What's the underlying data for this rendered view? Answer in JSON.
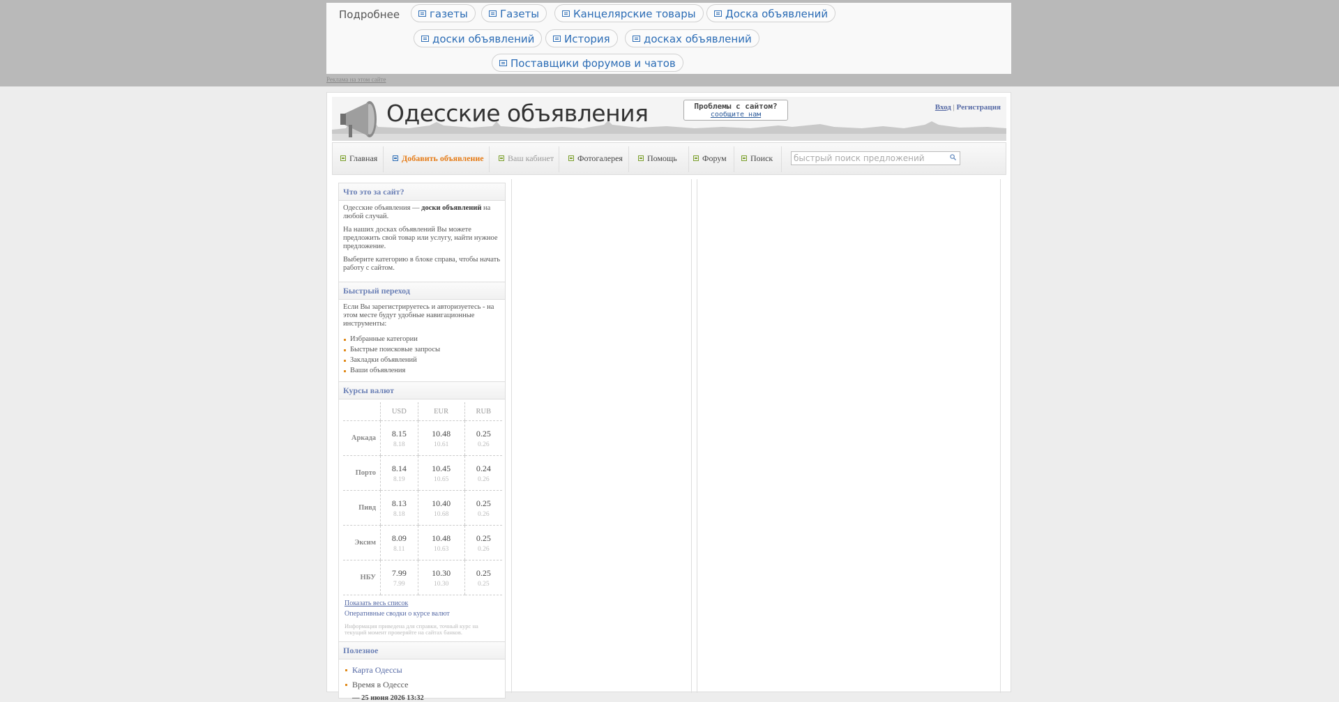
{
  "ad": {
    "more_label": "Подробнее",
    "chips": [
      "газеты",
      "Газеты",
      "Канцелярские товары",
      "Доска объявлений",
      "доски объявлений",
      "История",
      "досках объявлений",
      "Поставщики форумов и чатов"
    ],
    "link_label": "Реклама на этом сайте"
  },
  "header": {
    "site_title": "Одесские объявления",
    "problem_line1": "Проблемы с сайтом?",
    "problem_line2": "сообщите нам",
    "login_label": "Вход",
    "separator": "|",
    "register_label": "Регистрация"
  },
  "nav": {
    "items": [
      "Главная",
      "Добавить объявление",
      "Ваш кабинет",
      "Фотогалерея",
      "Помощь",
      "Форум",
      "Поиск"
    ],
    "search_placeholder": "быстрый поиск предложений"
  },
  "sidebar": {
    "about": {
      "title": "Что это за сайт?",
      "p1_a": "Одесские объявления — ",
      "p1_b": "доски объявлений",
      "p1_c": " на любой случай.",
      "p2": "На наших досках объявлений Вы можете предложить свой товар или услугу, найти нужное предложение.",
      "p3": "Выберите категорию в блоке справа, чтобы начать работу с сайтом."
    },
    "quick": {
      "title": "Быстрый переход",
      "text": "Если Вы зарегистрируетесь и авторизуетесь - на этом месте будут удобные навигационные инструменты:",
      "items": [
        "Избранные категории",
        "Быстрые поисковые запросы",
        "Закладки объявлений",
        "Ваши объявления"
      ]
    },
    "rates": {
      "title": "Курсы валют",
      "currencies": [
        "USD",
        "EUR",
        "RUB"
      ],
      "rows": [
        {
          "bank": "Аркада",
          "vals": [
            [
              "8.15",
              "8.18"
            ],
            [
              "10.48",
              "10.61"
            ],
            [
              "0.25",
              "0.26"
            ]
          ]
        },
        {
          "bank": "Порто",
          "vals": [
            [
              "8.14",
              "8.19"
            ],
            [
              "10.45",
              "10.65"
            ],
            [
              "0.24",
              "0.26"
            ]
          ]
        },
        {
          "bank": "Пивд",
          "vals": [
            [
              "8.13",
              "8.18"
            ],
            [
              "10.40",
              "10.68"
            ],
            [
              "0.25",
              "0.26"
            ]
          ]
        },
        {
          "bank": "Эксим",
          "vals": [
            [
              "8.09",
              "8.11"
            ],
            [
              "10.48",
              "10.63"
            ],
            [
              "0.25",
              "0.26"
            ]
          ]
        },
        {
          "bank": "НБУ",
          "vals": [
            [
              "7.99",
              "7.99"
            ],
            [
              "10.30",
              "10.30"
            ],
            [
              "0.25",
              "0.25"
            ]
          ]
        }
      ],
      "show_all_label": "Показать весь список",
      "summary_label": "Оперативные сводки о курсе валют",
      "note": "Информация приведена для справки, точный курс на текущий момент проверяйте на сайтах банков."
    },
    "useful": {
      "title": "Полезное",
      "map_label": "Карта Одессы",
      "time_label": "Время в Одессе",
      "date": "— 25 июня 2026 13:32"
    }
  }
}
